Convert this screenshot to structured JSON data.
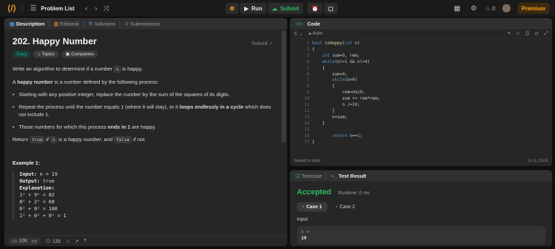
{
  "topbar": {
    "problem_list": "Problem List",
    "run_label": "Run",
    "submit_label": "Submit",
    "streak_count": "0",
    "premium_label": "Premium"
  },
  "desc_tabs": [
    "Description",
    "Editorial",
    "Solutions",
    "Submissions"
  ],
  "problem": {
    "title": "202. Happy Number",
    "solved": "Solved",
    "tags": [
      "Easy",
      "Topics",
      "Companies"
    ],
    "intro_pre": "Write an algorithm to determine if a number ",
    "intro_code": "n",
    "intro_post": " is happy.",
    "def_pre": "A ",
    "def_bold": "happy number",
    "def_post": " is a number defined by the following process:",
    "bullets": [
      {
        "pre": "Starting with any positive integer, replace the number by the sum of the squares of its digits.",
        "bold": "",
        "post": ""
      },
      {
        "pre": "Repeat the process until the number equals 1 (where it will stay), or it ",
        "bold": "loops endlessly in a cycle",
        "post": " which does not include 1."
      },
      {
        "pre": "Those numbers for which this process ",
        "bold": "ends in 1",
        "post": " are happy."
      }
    ],
    "return_pre": "Return ",
    "return_true": "true",
    "return_mid1": " if ",
    "return_n": "n",
    "return_mid2": " is a happy number, and ",
    "return_false": "false",
    "return_post": " if not.",
    "example_title": "Example 1:",
    "example": {
      "input_label": "Input:",
      "input_value": " n = 19",
      "output_label": "Output:",
      "output_value": " true",
      "explanation_label": "Explanation:",
      "lines": [
        "1² + 9² = 82",
        "8² + 2² = 68",
        "6² + 8² = 100",
        "1² + 0² + 0² = 1"
      ]
    }
  },
  "footer": {
    "likes": "10K",
    "comments": "135"
  },
  "code_panel": {
    "title": "Code",
    "language": "C",
    "mode": "Auto",
    "line_numbers": [
      "1",
      "2",
      "3",
      "4",
      "5",
      "6",
      "7",
      "8",
      "9",
      "10",
      "11",
      "12",
      "13",
      "14",
      "15",
      "16",
      "17"
    ],
    "saved": "Saved to local",
    "cursor": "Ln 3, Col 8"
  },
  "result_panel": {
    "tab_testcase": "Testcase",
    "tab_result": "Test Result",
    "status": "Accepted",
    "runtime": "Runtime: 0 ms",
    "cases": [
      "Case 1",
      "Case 2"
    ],
    "input_label": "Input",
    "input_var": "n =",
    "input_value": "19"
  },
  "colors": {
    "accepted": "#2cbb5d",
    "premium": "#ffa116",
    "easy": "#00b8a3"
  }
}
